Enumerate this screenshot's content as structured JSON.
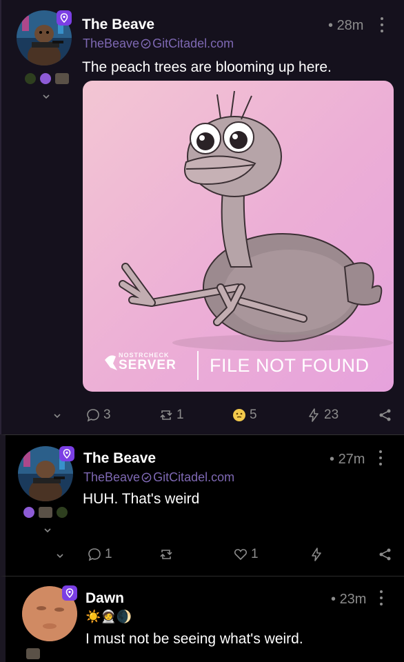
{
  "posts": [
    {
      "author": "The Beave",
      "handle": "TheBeave",
      "domain": "GitCitadel.com",
      "time": "28m",
      "text": "The peach trees are blooming up here.",
      "media": {
        "brand_small": "NOSTRCHECK",
        "brand_main": "SERVER",
        "message": "FILE NOT FOUND"
      },
      "replies": "3",
      "reposts": "1",
      "reactions": "5",
      "zaps": "23"
    },
    {
      "author": "The Beave",
      "handle": "TheBeave",
      "domain": "GitCitadel.com",
      "time": "27m",
      "text": "HUH. That's weird",
      "replies": "1",
      "reposts": "",
      "reactions": "1",
      "zaps": ""
    },
    {
      "author": "Dawn",
      "time": "23m",
      "status_emoji": "☀️🧑‍🚀🌒",
      "text": "I must not be seeing what's weird."
    }
  ],
  "colors": {
    "accent": "#7b3fe4",
    "handle": "#7e68b3",
    "muted": "#8c8c8c",
    "zap": "#f2c94c"
  }
}
